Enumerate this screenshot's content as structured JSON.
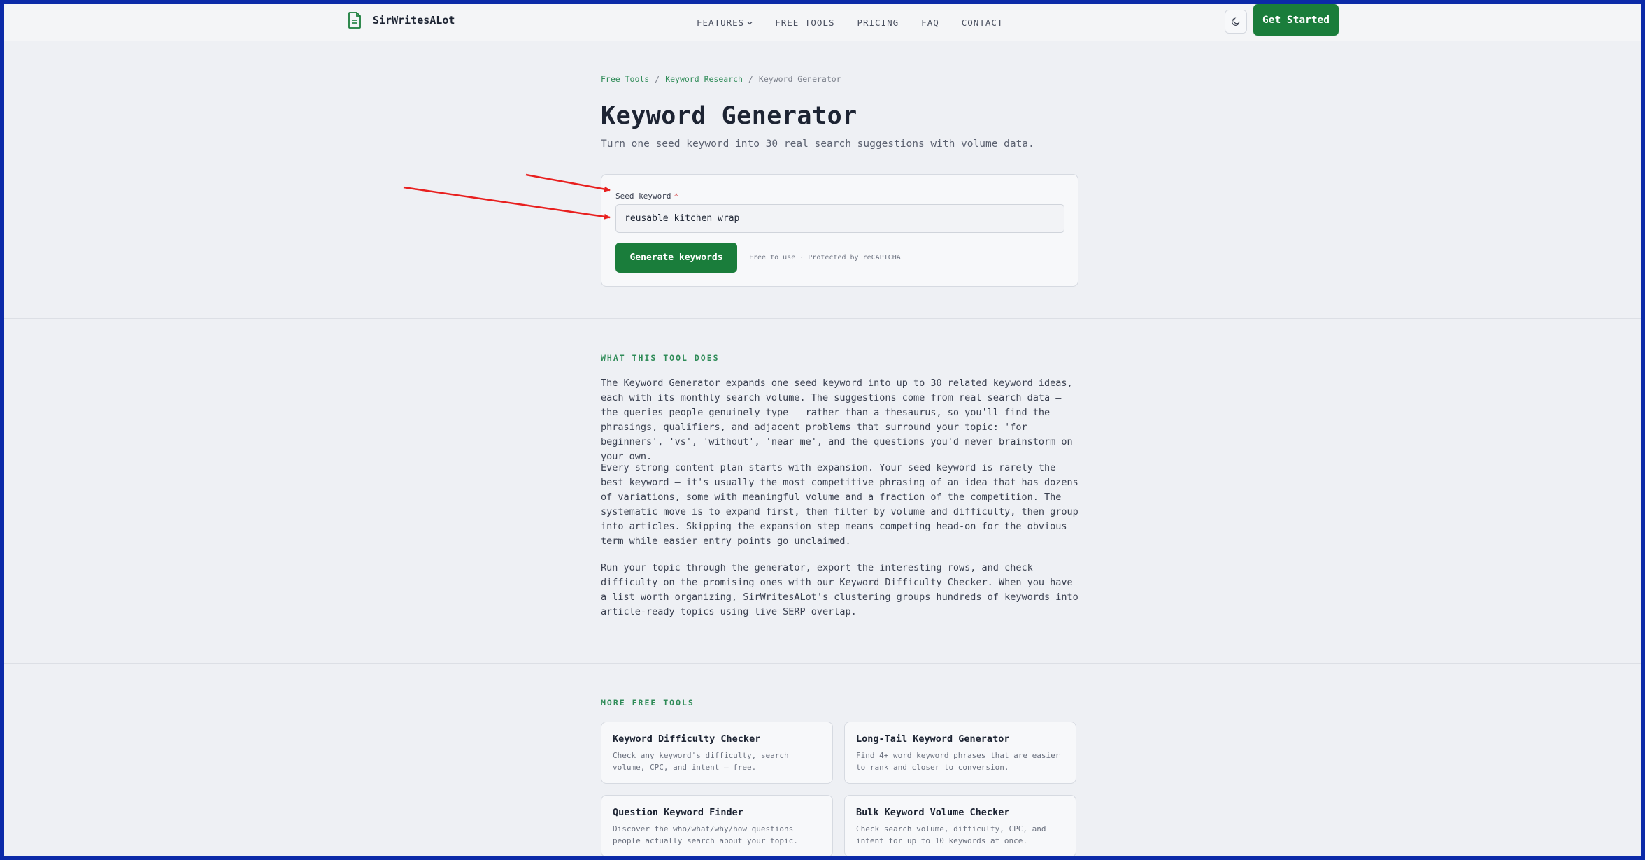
{
  "brand": {
    "name": "SirWritesALot",
    "icon": "document-icon"
  },
  "nav": {
    "items": [
      {
        "label": "FEATURES",
        "has_dropdown": true
      },
      {
        "label": "FREE TOOLS"
      },
      {
        "label": "PRICING"
      },
      {
        "label": "FAQ"
      },
      {
        "label": "CONTACT"
      }
    ],
    "theme_toggle_icon": "moon-icon",
    "cta_label": "Get Started"
  },
  "breadcrumb": {
    "items": [
      "Free Tools",
      "Keyword Research",
      "Keyword Generator"
    ],
    "separator": "/"
  },
  "page": {
    "title": "Keyword Generator",
    "subtitle": "Turn one seed keyword into 30 real search suggestions with volume data."
  },
  "form": {
    "label": "Seed keyword",
    "required_mark": "*",
    "value": "reusable kitchen wrap",
    "submit_label": "Generate keywords",
    "note": "Free to use · Protected by reCAPTCHA"
  },
  "about": {
    "heading": "WHAT THIS TOOL DOES",
    "paragraphs": [
      "The Keyword Generator expands one seed keyword into up to 30 related keyword ideas, each with its monthly search volume. The suggestions come from real search data — the queries people genuinely type — rather than a thesaurus, so you'll find the phrasings, qualifiers, and adjacent problems that surround your topic: 'for beginners', 'vs', 'without', 'near me', and the questions you'd never brainstorm on your own.",
      "Every strong content plan starts with expansion. Your seed keyword is rarely the best keyword — it's usually the most competitive phrasing of an idea that has dozens of variations, some with meaningful volume and a fraction of the competition. The systematic move is to expand first, then filter by volume and difficulty, then group into articles. Skipping the expansion step means competing head-on for the obvious term while easier entry points go unclaimed.",
      "Run your topic through the generator, export the interesting rows, and check difficulty on the promising ones with our Keyword Difficulty Checker. When you have a list worth organizing, SirWritesALot's clustering groups hundreds of keywords into article-ready topics using live SERP overlap."
    ]
  },
  "more_tools": {
    "heading": "MORE FREE TOOLS",
    "items": [
      {
        "name": "Keyword Difficulty Checker",
        "desc": "Check any keyword's difficulty, search volume, CPC, and intent — free."
      },
      {
        "name": "Long-Tail Keyword Generator",
        "desc": "Find 4+ word keyword phrases that are easier to rank and closer to conversion."
      },
      {
        "name": "Question Keyword Finder",
        "desc": "Discover the who/what/why/how questions people actually search about your topic."
      },
      {
        "name": "Bulk Keyword Volume Checker",
        "desc": "Check search volume, difficulty, CPC, and intent for up to 10 keywords at once."
      }
    ]
  },
  "colors": {
    "accent": "#1a7d3b",
    "link": "#2e8b57",
    "annotation": "#e8201f",
    "frame_border": "#0b2aa8"
  }
}
